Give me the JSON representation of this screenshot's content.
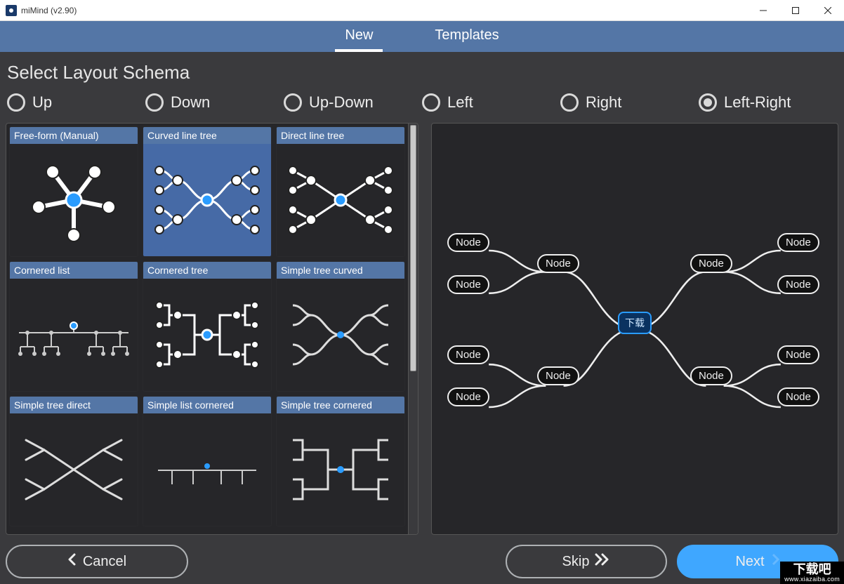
{
  "window": {
    "title": "miMind (v2.90)"
  },
  "tabs": {
    "new": "New",
    "templates": "Templates",
    "active": "new"
  },
  "heading": "Select Layout Schema",
  "radios": {
    "items": [
      {
        "key": "up",
        "label": "Up"
      },
      {
        "key": "down",
        "label": "Down"
      },
      {
        "key": "updown",
        "label": "Up-Down"
      },
      {
        "key": "left",
        "label": "Left"
      },
      {
        "key": "right",
        "label": "Right"
      },
      {
        "key": "leftright",
        "label": "Left-Right"
      }
    ],
    "selected": "leftright"
  },
  "gallery": {
    "selected": "curved_line_tree",
    "items": {
      "free_form": "Free-form (Manual)",
      "curved_line_tree": "Curved line tree",
      "direct_line_tree": "Direct line tree",
      "cornered_list": "Cornered list",
      "cornered_tree": "Cornered tree",
      "simple_tree_curved": "Simple tree curved",
      "simple_tree_direct": "Simple tree direct",
      "simple_list_cornered": "Simple list cornered",
      "simple_tree_cornered": "Simple tree cornered"
    }
  },
  "preview": {
    "center_label": "下载",
    "node_label": "Node"
  },
  "buttons": {
    "cancel": "Cancel",
    "skip": "Skip",
    "next": "Next"
  },
  "watermark": {
    "main": "下载吧",
    "sub": "www.xiazaiba.com"
  },
  "colors": {
    "accent": "#5476a6",
    "primary_button": "#3fa7ff",
    "panel_bg": "#262629",
    "app_bg": "#3a3a3d"
  }
}
